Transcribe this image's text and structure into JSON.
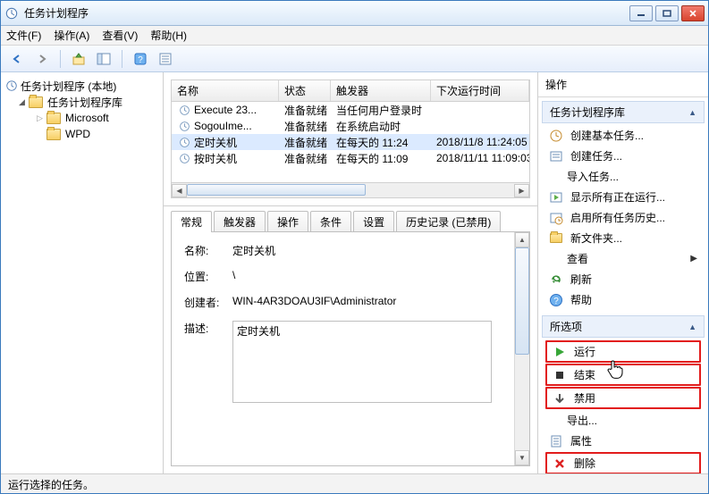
{
  "window": {
    "title": "任务计划程序"
  },
  "menu": {
    "file": "文件(F)",
    "action": "操作(A)",
    "view": "查看(V)",
    "help": "帮助(H)"
  },
  "tree": {
    "root": "任务计划程序 (本地)",
    "lib": "任务计划程序库",
    "children": [
      "Microsoft",
      "WPD"
    ]
  },
  "grid": {
    "headers": {
      "name": "名称",
      "state": "状态",
      "trigger": "触发器",
      "next": "下次运行时间"
    },
    "rows": [
      {
        "name": "Execute 23...",
        "state": "准备就绪",
        "trigger": "当任何用户登录时",
        "next": ""
      },
      {
        "name": "SogouIme...",
        "state": "准备就绪",
        "trigger": "在系统启动时",
        "next": ""
      },
      {
        "name": "定时关机",
        "state": "准备就绪",
        "trigger": "在每天的 11:24",
        "next": "2018/11/8 11:24:05"
      },
      {
        "name": "按时关机",
        "state": "准备就绪",
        "trigger": "在每天的 11:09",
        "next": "2018/11/11 11:09:03"
      }
    ],
    "selected_index": 2
  },
  "details": {
    "tabs": [
      "常规",
      "触发器",
      "操作",
      "条件",
      "设置",
      "历史记录 (已禁用)"
    ],
    "active_tab": 0,
    "general": {
      "name_label": "名称:",
      "name_value": "定时关机",
      "location_label": "位置:",
      "location_value": "\\",
      "author_label": "创建者:",
      "author_value": "WIN-4AR3DOAU3IF\\Administrator",
      "desc_label": "描述:",
      "desc_value": "定时关机"
    }
  },
  "actions": {
    "pane_title": "操作",
    "section1": "任务计划程序库",
    "section2": "所选项",
    "items1": [
      {
        "icon": "create-basic",
        "label": "创建基本任务..."
      },
      {
        "icon": "create",
        "label": "创建任务..."
      },
      {
        "icon": "none",
        "label": "导入任务..."
      },
      {
        "icon": "running",
        "label": "显示所有正在运行..."
      },
      {
        "icon": "history",
        "label": "启用所有任务历史..."
      },
      {
        "icon": "folder",
        "label": "新文件夹..."
      },
      {
        "icon": "none",
        "label": "查看",
        "submenu": true
      },
      {
        "icon": "refresh",
        "label": "刷新"
      },
      {
        "icon": "help",
        "label": "帮助"
      }
    ],
    "items2": [
      {
        "icon": "run",
        "label": "运行",
        "hl": true
      },
      {
        "icon": "stop",
        "label": "结束",
        "hl": true
      },
      {
        "icon": "disable",
        "label": "禁用",
        "hl": true
      },
      {
        "icon": "none",
        "label": "导出..."
      },
      {
        "icon": "props",
        "label": "属性"
      },
      {
        "icon": "delete",
        "label": "删除",
        "hl": true
      }
    ]
  },
  "status": "运行选择的任务。"
}
